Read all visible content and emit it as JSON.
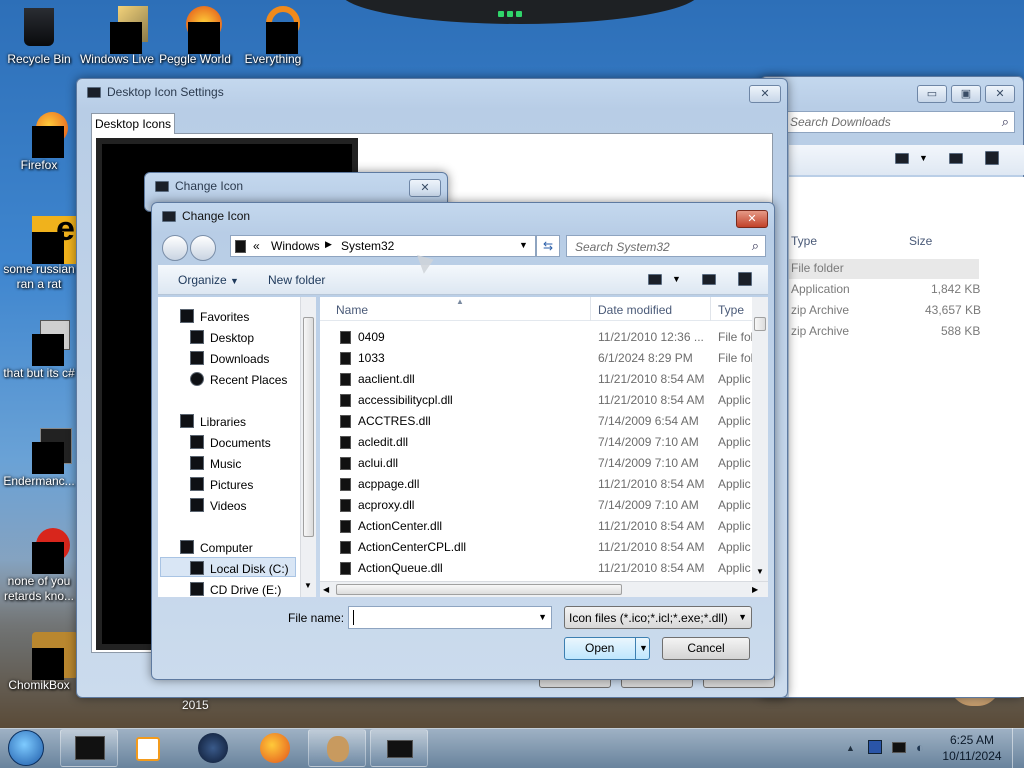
{
  "desktop": {
    "icons": [
      {
        "label": "Recycle Bin"
      },
      {
        "label": "Windows Live"
      },
      {
        "label": "Peggle World"
      },
      {
        "label": "Everything"
      },
      {
        "label": "Firefox"
      },
      {
        "label": "some russian ran a rat"
      },
      {
        "label": "that but its c#"
      },
      {
        "label": "Endermanc..."
      },
      {
        "label": "none of you retards kno..."
      },
      {
        "label": "ChomikBox"
      }
    ],
    "year_label": "2015"
  },
  "bg_explorer": {
    "search_placeholder": "Search Downloads",
    "columns": {
      "type": "Type",
      "size": "Size"
    },
    "rows": [
      {
        "type": "File folder",
        "size": ""
      },
      {
        "type": "Application",
        "size": "1,842 KB"
      },
      {
        "type": "zip Archive",
        "size": "43,657 KB"
      },
      {
        "type": "zip Archive",
        "size": "588 KB"
      }
    ],
    "controls": {
      "minimize": "▭",
      "maximize": "▣",
      "close": "✕"
    }
  },
  "desktop_icon_settings": {
    "title": "Desktop Icon Settings",
    "tab": "Desktop Icons"
  },
  "change_icon_back": {
    "title": "Change Icon"
  },
  "change_icon_dialog": {
    "title": "Change Icon",
    "breadcrumb": {
      "prefix": "«",
      "parts": [
        "Windows",
        "System32"
      ]
    },
    "search_placeholder": "Search System32",
    "toolbar": {
      "organize": "Organize",
      "new_folder": "New folder"
    },
    "nav": {
      "favorites": "Favorites",
      "favorites_items": [
        "Desktop",
        "Downloads",
        "Recent Places"
      ],
      "libraries": "Libraries",
      "libraries_items": [
        "Documents",
        "Music",
        "Pictures",
        "Videos"
      ],
      "computer": "Computer",
      "computer_items": [
        "Local Disk (C:)",
        "CD Drive (E:)"
      ]
    },
    "columns": {
      "name": "Name",
      "date": "Date modified",
      "type": "Type"
    },
    "files": [
      {
        "name": "0409",
        "date": "11/21/2010 12:36 ...",
        "type": "File fol"
      },
      {
        "name": "1033",
        "date": "6/1/2024 8:29 PM",
        "type": "File fol"
      },
      {
        "name": "aaclient.dll",
        "date": "11/21/2010 8:54 AM",
        "type": "Applic"
      },
      {
        "name": "accessibilitycpl.dll",
        "date": "11/21/2010 8:54 AM",
        "type": "Applic"
      },
      {
        "name": "ACCTRES.dll",
        "date": "7/14/2009 6:54 AM",
        "type": "Applic"
      },
      {
        "name": "acledit.dll",
        "date": "7/14/2009 7:10 AM",
        "type": "Applic"
      },
      {
        "name": "aclui.dll",
        "date": "7/14/2009 7:10 AM",
        "type": "Applic"
      },
      {
        "name": "acppage.dll",
        "date": "11/21/2010 8:54 AM",
        "type": "Applic"
      },
      {
        "name": "acproxy.dll",
        "date": "7/14/2009 7:10 AM",
        "type": "Applic"
      },
      {
        "name": "ActionCenter.dll",
        "date": "11/21/2010 8:54 AM",
        "type": "Applic"
      },
      {
        "name": "ActionCenterCPL.dll",
        "date": "11/21/2010 8:54 AM",
        "type": "Applic"
      },
      {
        "name": "ActionQueue.dll",
        "date": "11/21/2010 8:54 AM",
        "type": "Applic"
      }
    ],
    "file_name_label": "File name:",
    "file_name_value": "",
    "filter": "Icon files (*.ico;*.icl;*.exe;*.dll)",
    "open_label": "Open",
    "cancel_label": "Cancel"
  },
  "taskbar": {
    "time": "6:25 AM",
    "date": "10/11/2024"
  },
  "colors": {
    "accent": "#3f86cf",
    "title_text": "#2b3a4e",
    "selection": "#cde3f7"
  }
}
